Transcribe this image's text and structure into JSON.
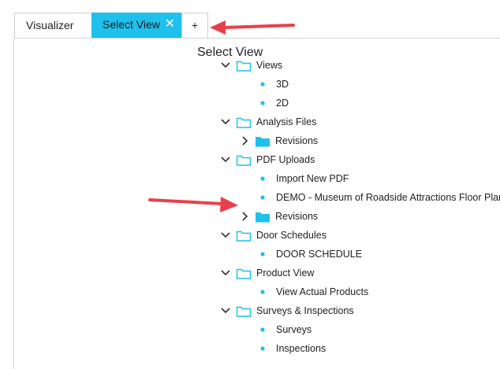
{
  "tabs": {
    "visualizer": "Visualizer",
    "select_view": "Select View",
    "close": "✕",
    "add": "+"
  },
  "panel": {
    "title": "Select View"
  },
  "tree": [
    {
      "label": "Views",
      "kind": "folder-open",
      "level": 0
    },
    {
      "label": "3D",
      "kind": "leaf",
      "level": 1
    },
    {
      "label": "2D",
      "kind": "leaf",
      "level": 1
    },
    {
      "label": "Analysis Files",
      "kind": "folder-open",
      "level": 0
    },
    {
      "label": "Revisions",
      "kind": "folder-closed",
      "level": 1
    },
    {
      "label": "PDF Uploads",
      "kind": "folder-open",
      "level": 0
    },
    {
      "label": "Import New PDF",
      "kind": "leaf",
      "level": 1
    },
    {
      "label": "DEMO - Museum of Roadside Attractions Floor Plan",
      "kind": "leaf",
      "level": 1
    },
    {
      "label": "Revisions",
      "kind": "folder-closed",
      "level": 1
    },
    {
      "label": "Door Schedules",
      "kind": "folder-open",
      "level": 0
    },
    {
      "label": "DOOR SCHEDULE",
      "kind": "leaf",
      "level": 1
    },
    {
      "label": "Product View",
      "kind": "folder-open",
      "level": 0
    },
    {
      "label": "View Actual Products",
      "kind": "leaf",
      "level": 1
    },
    {
      "label": "Surveys & Inspections",
      "kind": "folder-open",
      "level": 0
    },
    {
      "label": "Surveys",
      "kind": "leaf",
      "level": 1
    },
    {
      "label": "Inspections",
      "kind": "leaf",
      "level": 1
    }
  ],
  "colors": {
    "accent": "#1ec0ec",
    "annotation_arrow": "#e8404a"
  },
  "icons": {
    "folder_open": "folder-outline-icon",
    "folder_closed": "folder-filled-icon",
    "expanded": "chevron-down-icon",
    "collapsed": "chevron-right-icon",
    "leaf": "bullet-icon"
  }
}
